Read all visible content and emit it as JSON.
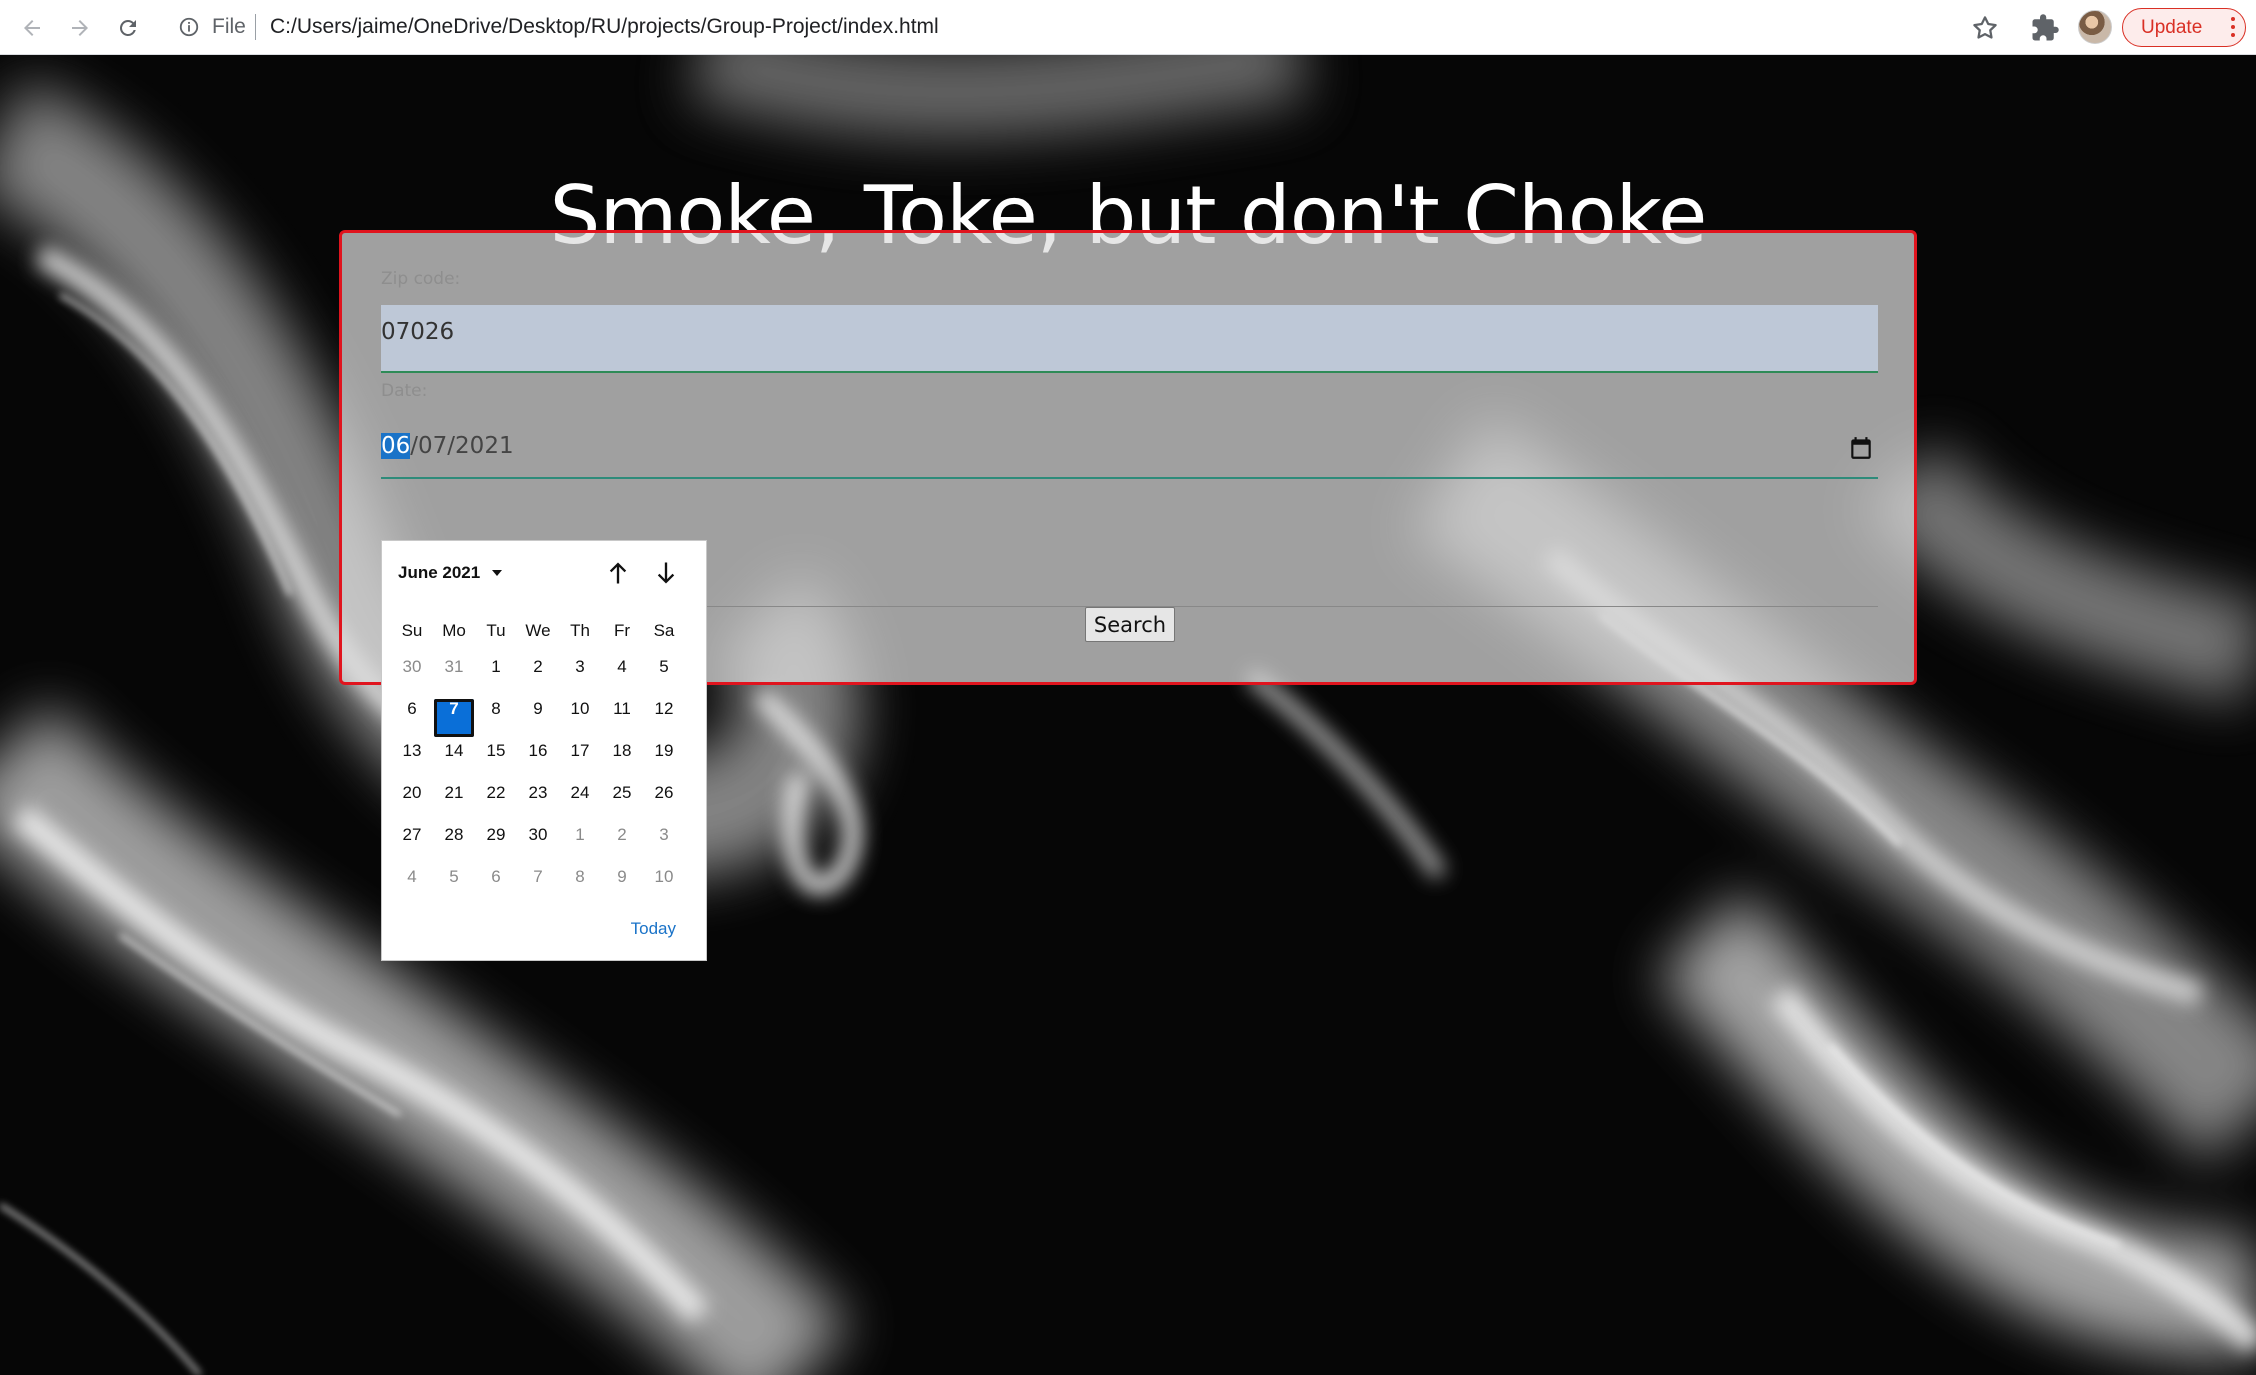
{
  "browser": {
    "url_scheme": "File",
    "url": "C:/Users/jaime/OneDrive/Desktop/RU/projects/Group-Project/index.html",
    "update_label": "Update"
  },
  "page": {
    "title": "Smoke, Toke, but don't Choke",
    "zip_label": "Zip code:",
    "zip_value": "07026",
    "date_label": "Date:",
    "date_month": "06",
    "date_rest": "/07/2021",
    "search_label": "Search"
  },
  "calendar": {
    "month_label": "June 2021",
    "weekdays": [
      "Su",
      "Mo",
      "Tu",
      "We",
      "Th",
      "Fr",
      "Sa"
    ],
    "weeks": [
      [
        "30",
        "31",
        "1",
        "2",
        "3",
        "4",
        "5"
      ],
      [
        "6",
        "7",
        "8",
        "9",
        "10",
        "11",
        "12"
      ],
      [
        "13",
        "14",
        "15",
        "16",
        "17",
        "18",
        "19"
      ],
      [
        "20",
        "21",
        "22",
        "23",
        "24",
        "25",
        "26"
      ],
      [
        "27",
        "28",
        "29",
        "30",
        "1",
        "2",
        "3"
      ],
      [
        "4",
        "5",
        "6",
        "7",
        "8",
        "9",
        "10"
      ]
    ],
    "muted_days": [
      [
        0,
        0
      ],
      [
        0,
        1
      ],
      [
        4,
        4
      ],
      [
        4,
        5
      ],
      [
        4,
        6
      ],
      [
        5,
        0
      ],
      [
        5,
        1
      ],
      [
        5,
        2
      ],
      [
        5,
        3
      ],
      [
        5,
        4
      ],
      [
        5,
        5
      ],
      [
        5,
        6
      ]
    ],
    "selected_day": [
      1,
      1
    ],
    "today_label": "Today"
  },
  "colors": {
    "accent": "#0a6fd8",
    "form_border": "#e0141e",
    "update": "#d93025"
  }
}
